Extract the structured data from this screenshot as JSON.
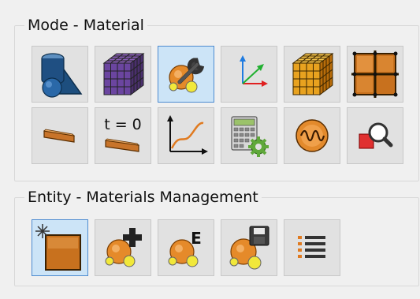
{
  "groups": {
    "mode": {
      "title": "Mode - Material",
      "buttons": [
        {
          "id": "shapes",
          "icon": "geometry-shapes-icon"
        },
        {
          "id": "mesh-cube",
          "icon": "mesh-cube-icon"
        },
        {
          "id": "material-tool",
          "icon": "material-wrench-icon",
          "active": true
        },
        {
          "id": "axes",
          "icon": "coordinate-axes-icon"
        },
        {
          "id": "cube-grid",
          "icon": "orange-cube-grid-icon"
        },
        {
          "id": "plane-grid",
          "icon": "plane-grid-icon"
        },
        {
          "id": "shell",
          "icon": "shell-plate-icon"
        },
        {
          "id": "initial-condition",
          "icon": "initial-condition-icon",
          "label": "t = 0"
        },
        {
          "id": "curve-plot",
          "icon": "curve-plot-icon"
        },
        {
          "id": "calculator",
          "icon": "calculator-gear-icon"
        },
        {
          "id": "wave",
          "icon": "wave-function-icon"
        },
        {
          "id": "inspect",
          "icon": "zoom-inspect-icon"
        }
      ]
    },
    "entity": {
      "title": "Entity - Materials Management",
      "buttons": [
        {
          "id": "new-material",
          "icon": "new-material-icon",
          "active": true
        },
        {
          "id": "add-material",
          "icon": "add-material-icon"
        },
        {
          "id": "edit-material",
          "icon": "edit-material-icon",
          "label": "E"
        },
        {
          "id": "save-material",
          "icon": "save-material-icon"
        },
        {
          "id": "list-materials",
          "icon": "list-icon"
        }
      ]
    }
  }
}
